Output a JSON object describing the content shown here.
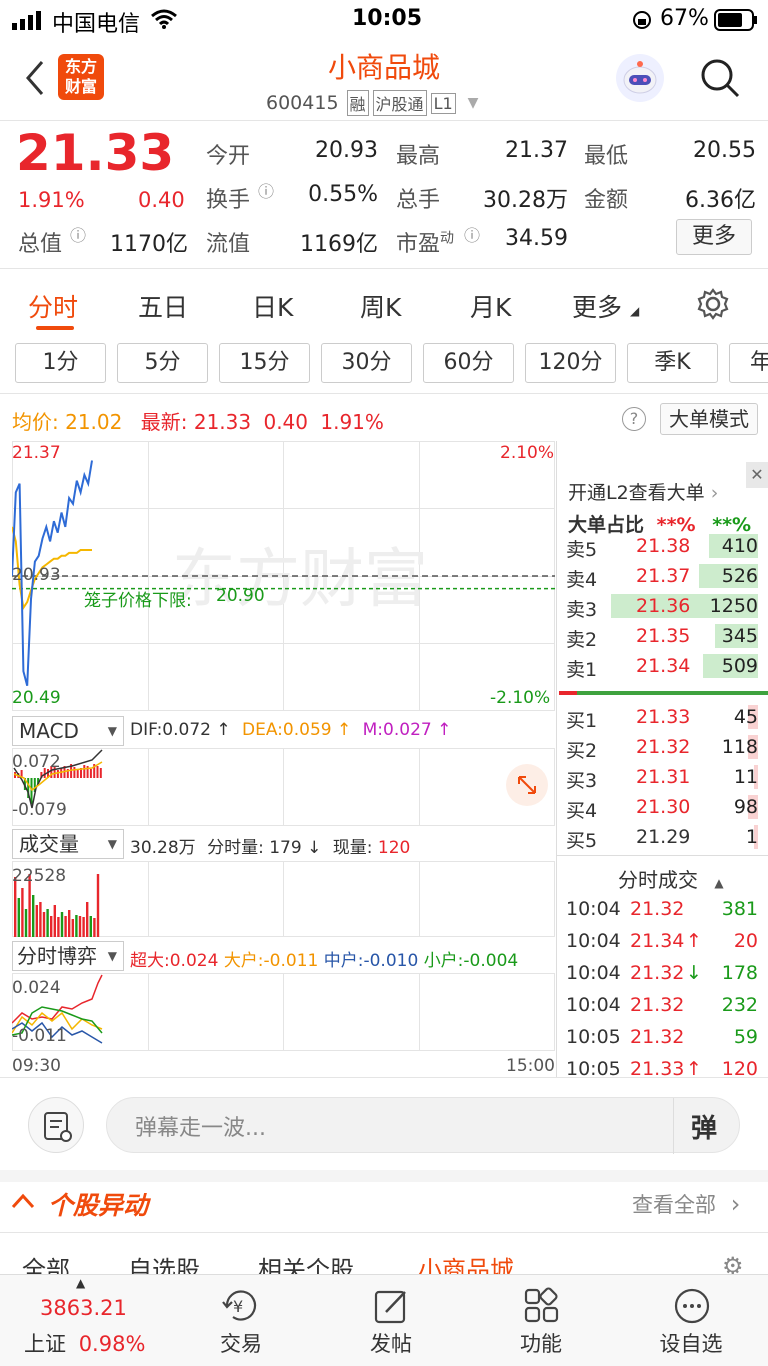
{
  "status_bar": {
    "carrier": "中国电信",
    "time": "10:05",
    "battery": "67%"
  },
  "header": {
    "logo_text": "东方财富",
    "stock_name": "小商品城",
    "code": "600415",
    "tags": [
      "融",
      "沪股通",
      "L1"
    ]
  },
  "quote": {
    "price": "21.33",
    "change_pct": "1.91%",
    "change": "0.40",
    "fields": [
      {
        "label": "今开",
        "value": "20.93",
        "color": "default"
      },
      {
        "label": "最高",
        "value": "21.37",
        "color": "red"
      },
      {
        "label": "最低",
        "value": "20.55",
        "color": "green"
      },
      {
        "label": "换手",
        "value": "0.55%",
        "color": "default"
      },
      {
        "label": "总手",
        "value": "30.28万",
        "color": "default"
      },
      {
        "label": "金额",
        "value": "6.36亿",
        "color": "default"
      },
      {
        "label": "总值",
        "value": "1170亿",
        "color": "default"
      },
      {
        "label": "流值",
        "value": "1169亿",
        "color": "default"
      },
      {
        "label": "市盈",
        "label_sup": "动",
        "value": "34.59",
        "color": "default"
      }
    ],
    "more_button": "更多"
  },
  "tabs": [
    "分时",
    "五日",
    "日K",
    "周K",
    "月K",
    "更多"
  ],
  "periods": [
    "1分",
    "5分",
    "15分",
    "30分",
    "60分",
    "120分",
    "季K",
    "年"
  ],
  "chart_info": {
    "avg_label": "均价:",
    "avg_value": "21.02",
    "latest_label": "最新:",
    "latest_price": "21.33",
    "latest_change": "0.40",
    "latest_pct": "1.91%",
    "big_order_mode": "大单模式"
  },
  "chart_data": {
    "type": "line",
    "y_high_label": "21.37",
    "y_low_label": "20.49",
    "pct_high_label": "2.10%",
    "pct_low_label": "-2.10%",
    "prev_close_label": "20.93",
    "limit_label": "笼子价格下限:",
    "limit_value": "20.90",
    "ylim": [
      20.49,
      21.37
    ],
    "prev_close": 20.93,
    "limit_line": 20.9,
    "series": [
      {
        "name": "price",
        "values": [
          20.93,
          21.22,
          21.25,
          20.6,
          20.55,
          20.85,
          20.98,
          21.0,
          21.06,
          21.1,
          21.05,
          21.12,
          21.08,
          21.15,
          21.1,
          21.2,
          21.18,
          21.26,
          21.22,
          21.28,
          21.25,
          21.33
        ]
      },
      {
        "name": "avg",
        "values": [
          21.1,
          21.05,
          20.9,
          20.82,
          20.84,
          20.88,
          20.92,
          20.94,
          20.96,
          20.97,
          20.98,
          20.99,
          20.99,
          21.0,
          21.0,
          21.01,
          21.01,
          21.01,
          21.02,
          21.02,
          21.02,
          21.02
        ]
      }
    ],
    "x_start": "09:30",
    "x_end": "15:00"
  },
  "macd": {
    "label": "MACD",
    "dif": "DIF:0.072 ↑",
    "dea": "DEA:0.059 ↑",
    "m": "M:0.027 ↑",
    "top": "0.072",
    "bottom": "-0.079"
  },
  "volume": {
    "label": "成交量",
    "total": "30.28万",
    "fen_label": "分时量:",
    "fen_value": "179 ↓",
    "now_label": "现量:",
    "now_value": "120",
    "top": "22528",
    "bars": [
      0.85,
      0.55,
      0.7,
      0.4,
      0.9,
      0.6,
      0.45,
      0.5,
      0.35,
      0.4,
      0.3,
      0.45,
      0.28,
      0.35,
      0.3,
      0.38,
      0.25,
      0.32,
      0.3,
      0.28,
      0.5,
      0.3,
      0.27,
      0.9
    ]
  },
  "game": {
    "label": "分时博弈",
    "super": "超大:0.024",
    "big": "大户:-0.011",
    "mid": "中户:-0.010",
    "small": "小户:-0.004",
    "top": "0.024",
    "bottom": "-0.011"
  },
  "order_book": {
    "l2_text": "开通L2查看大单",
    "ratio_label": "大单占比",
    "ratio_red": "**%",
    "ratio_green": "**%",
    "asks": [
      {
        "label": "卖5",
        "price": "21.38",
        "vol": "410",
        "level": 0.25
      },
      {
        "label": "卖4",
        "price": "21.37",
        "vol": "526",
        "level": 0.3
      },
      {
        "label": "卖3",
        "price": "21.36",
        "vol": "1250",
        "level": 0.75
      },
      {
        "label": "卖2",
        "price": "21.35",
        "vol": "345",
        "level": 0.22
      },
      {
        "label": "卖1",
        "price": "21.34",
        "vol": "509",
        "level": 0.28
      }
    ],
    "bids": [
      {
        "label": "买1",
        "price": "21.33",
        "vol": "45",
        "level": 0.05
      },
      {
        "label": "买2",
        "price": "21.32",
        "vol": "118",
        "level": 0.05
      },
      {
        "label": "买3",
        "price": "21.31",
        "vol": "11",
        "level": 0.02
      },
      {
        "label": "买4",
        "price": "21.30",
        "vol": "98",
        "level": 0.05
      },
      {
        "label": "买5",
        "price": "21.29",
        "vol": "1",
        "level": 0.02
      }
    ]
  },
  "trades": {
    "title": "分时成交",
    "rows": [
      {
        "time": "10:04",
        "price": "21.32",
        "arrow": "",
        "vol": "381",
        "vol_color": "green"
      },
      {
        "time": "10:04",
        "price": "21.34",
        "arrow": "↑",
        "vol": "20",
        "vol_color": "red"
      },
      {
        "time": "10:04",
        "price": "21.32",
        "arrow": "↓",
        "vol": "178",
        "vol_color": "green"
      },
      {
        "time": "10:04",
        "price": "21.32",
        "arrow": "",
        "vol": "232",
        "vol_color": "green"
      },
      {
        "time": "10:05",
        "price": "21.32",
        "arrow": "",
        "vol": "59",
        "vol_color": "green"
      },
      {
        "time": "10:05",
        "price": "21.33",
        "arrow": "↑",
        "vol": "120",
        "vol_color": "red"
      }
    ]
  },
  "danmu": {
    "placeholder": "弹幕走一波...",
    "button": "弹"
  },
  "movement": {
    "title": "个股异动",
    "view_all": "查看全部"
  },
  "sub_tabs": [
    "全部",
    "自选股",
    "相关个股",
    "小商品城"
  ],
  "bottom_bar": {
    "index_value": "3863.21",
    "index_name": "上证",
    "index_pct": "0.98%",
    "items": [
      "交易",
      "发帖",
      "功能",
      "设自选"
    ]
  }
}
